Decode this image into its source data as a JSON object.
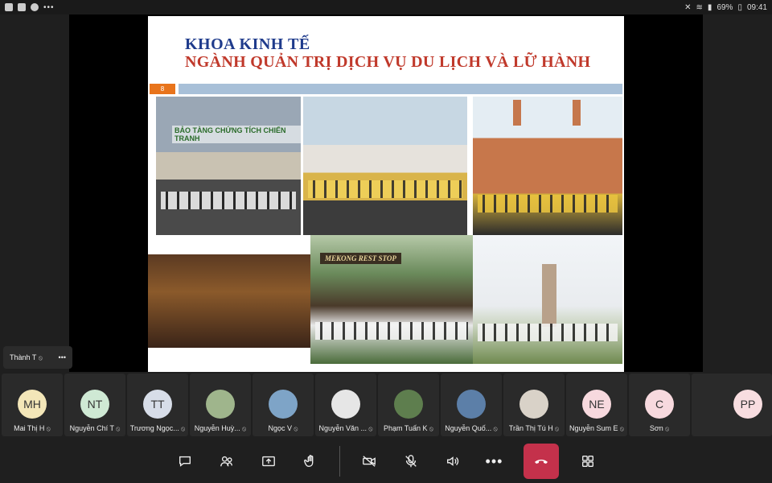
{
  "status_bar": {
    "battery": "69%",
    "time": "09:41",
    "overflow": "•••"
  },
  "slide": {
    "title_line1": "KHOA KINH TẾ",
    "title_line2": "NGÀNH QUẢN TRỊ DỊCH VỤ DU LỊCH VÀ LỮ HÀNH",
    "page_number": "8",
    "photo_labels": {
      "museum_sign": "BẢO TÀNG CHỨNG TÍCH CHIẾN TRANH",
      "rest_stop_sign": "MEKONG REST STOP"
    }
  },
  "self_tile": {
    "name": "Thành T",
    "menu": "•••"
  },
  "participants": [
    {
      "initials": "MH",
      "name": "Mai Thị H",
      "color": "#f3e6b8"
    },
    {
      "initials": "NT",
      "name": "Nguyễn Chí T",
      "color": "#cfe9d4"
    },
    {
      "initials": "TT",
      "name": "Trương Ngọc...",
      "color": "#d7dde8"
    },
    {
      "initials": "",
      "name": "Nguyễn Huỳ...",
      "color": "#9fb58c"
    },
    {
      "initials": "",
      "name": "Ngọc V",
      "color": "#7ea4c7"
    },
    {
      "initials": "",
      "name": "Nguyễn Văn ...",
      "color": "#e6e6e6"
    },
    {
      "initials": "",
      "name": "Phạm Tuấn K",
      "color": "#5e7e4e"
    },
    {
      "initials": "",
      "name": "Nguyễn Quố...",
      "color": "#5c7fa8"
    },
    {
      "initials": "",
      "name": "Trần Thị Tú H",
      "color": "#d9d2c8"
    },
    {
      "initials": "NE",
      "name": "Nguyễn Sum E",
      "color": "#f7d9de"
    },
    {
      "initials": "C",
      "name": "Sơn",
      "color": "#f7d9de"
    }
  ],
  "overflow_participant": {
    "initials": "PP",
    "color": "#f8dde0"
  },
  "toolbar": {
    "buttons": [
      "chat",
      "people",
      "share",
      "raise-hand",
      "camera-off",
      "mic-off",
      "speaker",
      "more",
      "hangup",
      "layout"
    ]
  }
}
